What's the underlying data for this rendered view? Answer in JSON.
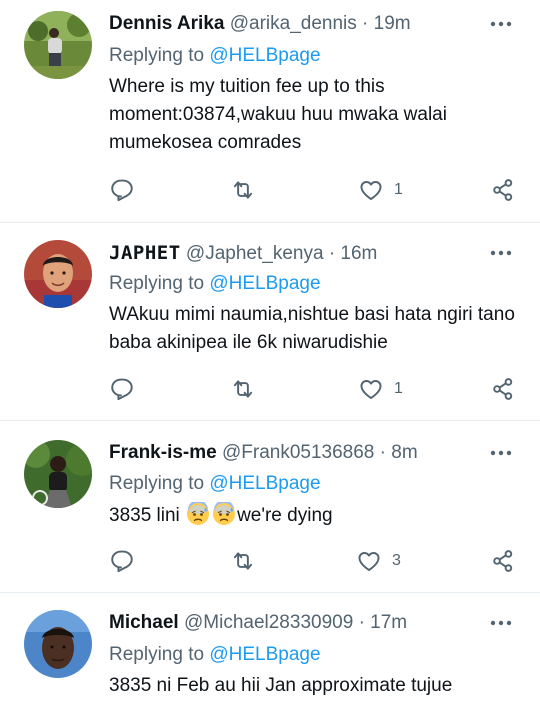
{
  "replying_prefix": "Replying to",
  "tweets": [
    {
      "name": "Dennis Arika",
      "handle": "@arika_dennis",
      "separator": "·",
      "time": "19m",
      "reply_to": "@HELBpage",
      "text": "Where is my tuition fee up to this moment:03874,wakuu huu mwaka walai mumekosea comrades",
      "reply_count": "",
      "retweet_count": "",
      "like_count": "1"
    },
    {
      "name": "JAPHET",
      "handle": "@Japhet_kenya",
      "separator": "·",
      "time": "16m",
      "reply_to": "@HELBpage",
      "text": "WAkuu mimi naumia,nishtue basi hata ngiri tano baba akinipea ile 6k niwarudishie",
      "reply_count": "",
      "retweet_count": "",
      "like_count": "1"
    },
    {
      "name": "Frank-is-me",
      "handle": "@Frank05136868",
      "separator": "·",
      "time": "8m",
      "reply_to": "@HELBpage",
      "text_before": "3835 lini",
      "text_after": "we're dying",
      "emoji": "anxious-face-with-sweat",
      "reply_count": "",
      "retweet_count": "",
      "like_count": "3"
    },
    {
      "name": "Michael",
      "handle": "@Michael28330909",
      "separator": "·",
      "time": "17m",
      "reply_to": "@HELBpage",
      "text": "3835 ni Feb au hii Jan approximate tujue"
    }
  ],
  "colors": {
    "text": "#0f1419",
    "secondary": "#536471",
    "link": "#1d9bf0",
    "divider": "#e6ecf0"
  },
  "icons": [
    "reply-icon",
    "retweet-icon",
    "like-icon",
    "share-icon",
    "more-icon"
  ]
}
